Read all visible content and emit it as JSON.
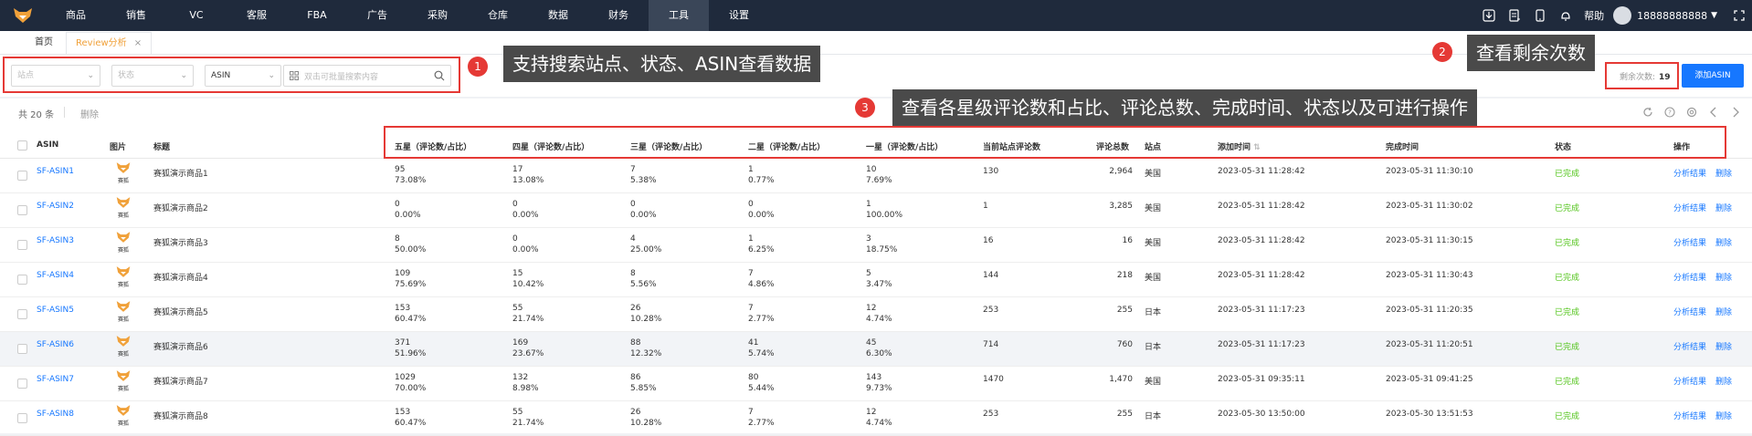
{
  "nav": {
    "items": [
      "商品",
      "销售",
      "VC",
      "客服",
      "FBA",
      "广告",
      "采购",
      "仓库",
      "数据",
      "财务",
      "工具",
      "设置"
    ],
    "active_index": 10,
    "help": "帮助",
    "user": "18888888888"
  },
  "tabs": {
    "home": "首页",
    "active": "Review分析",
    "close": "×"
  },
  "filters": {
    "site_placeholder": "站点",
    "status_placeholder": "状态",
    "type_value": "ASIN",
    "search_placeholder": "双击可批量搜索内容"
  },
  "annotations": {
    "a1_num": "1",
    "a1_text": "支持搜索站点、状态、ASIN查看数据",
    "a2_num": "2",
    "a2_text": "查看剩余次数",
    "a3_num": "3",
    "a3_text": "查看各星级评论数和占比、评论总数、完成时间、状态以及可进行操作"
  },
  "remaining": {
    "label": "剩余次数:",
    "value": "19"
  },
  "add_button": "添加ASIN",
  "toolbar": {
    "count": "共 20 条",
    "delete": "删除"
  },
  "columns": {
    "asin": "ASIN",
    "image": "图片",
    "title": "标题",
    "five": "五星（评论数/占比）",
    "four": "四星（评论数/占比）",
    "three": "三星（评论数/占比）",
    "two": "二星（评论数/占比）",
    "one": "一星（评论数/占比）",
    "site_reviews": "当前站点评论数",
    "total": "评论总数",
    "site": "站点",
    "added": "添加时间",
    "completed": "完成时间",
    "status": "状态",
    "action": "操作"
  },
  "thumb_text": "赛狐",
  "rows": [
    {
      "asin": "SF-ASIN1",
      "title": "赛狐演示商品1",
      "s5": "95",
      "p5": "73.08%",
      "s4": "17",
      "p4": "13.08%",
      "s3": "7",
      "p3": "5.38%",
      "s2": "1",
      "p2": "0.77%",
      "s1": "10",
      "p1": "7.69%",
      "site_reviews": "130",
      "total": "2,964",
      "site": "美国",
      "added": "2023-05-31 11:28:42",
      "completed": "2023-05-31 11:30:10",
      "status": "已完成",
      "act1": "分析结果",
      "act2": "删除"
    },
    {
      "asin": "SF-ASIN2",
      "title": "赛狐演示商品2",
      "s5": "0",
      "p5": "0.00%",
      "s4": "0",
      "p4": "0.00%",
      "s3": "0",
      "p3": "0.00%",
      "s2": "0",
      "p2": "0.00%",
      "s1": "1",
      "p1": "100.00%",
      "site_reviews": "1",
      "total": "3,285",
      "site": "美国",
      "added": "2023-05-31 11:28:42",
      "completed": "2023-05-31 11:30:02",
      "status": "已完成",
      "act1": "分析结果",
      "act2": "删除"
    },
    {
      "asin": "SF-ASIN3",
      "title": "赛狐演示商品3",
      "s5": "8",
      "p5": "50.00%",
      "s4": "0",
      "p4": "0.00%",
      "s3": "4",
      "p3": "25.00%",
      "s2": "1",
      "p2": "6.25%",
      "s1": "3",
      "p1": "18.75%",
      "site_reviews": "16",
      "total": "16",
      "site": "美国",
      "added": "2023-05-31 11:28:42",
      "completed": "2023-05-31 11:30:15",
      "status": "已完成",
      "act1": "分析结果",
      "act2": "删除"
    },
    {
      "asin": "SF-ASIN4",
      "title": "赛狐演示商品4",
      "s5": "109",
      "p5": "75.69%",
      "s4": "15",
      "p4": "10.42%",
      "s3": "8",
      "p3": "5.56%",
      "s2": "7",
      "p2": "4.86%",
      "s1": "5",
      "p1": "3.47%",
      "site_reviews": "144",
      "total": "218",
      "site": "美国",
      "added": "2023-05-31 11:28:42",
      "completed": "2023-05-31 11:30:43",
      "status": "已完成",
      "act1": "分析结果",
      "act2": "删除"
    },
    {
      "asin": "SF-ASIN5",
      "title": "赛狐演示商品5",
      "s5": "153",
      "p5": "60.47%",
      "s4": "55",
      "p4": "21.74%",
      "s3": "26",
      "p3": "10.28%",
      "s2": "7",
      "p2": "2.77%",
      "s1": "12",
      "p1": "4.74%",
      "site_reviews": "253",
      "total": "255",
      "site": "日本",
      "added": "2023-05-31 11:17:23",
      "completed": "2023-05-31 11:20:35",
      "status": "已完成",
      "act1": "分析结果",
      "act2": "删除"
    },
    {
      "asin": "SF-ASIN6",
      "title": "赛狐演示商品6",
      "s5": "371",
      "p5": "51.96%",
      "s4": "169",
      "p4": "23.67%",
      "s3": "88",
      "p3": "12.32%",
      "s2": "41",
      "p2": "5.74%",
      "s1": "45",
      "p1": "6.30%",
      "site_reviews": "714",
      "total": "760",
      "site": "日本",
      "added": "2023-05-31 11:17:23",
      "completed": "2023-05-31 11:20:51",
      "status": "已完成",
      "act1": "分析结果",
      "act2": "删除"
    },
    {
      "asin": "SF-ASIN7",
      "title": "赛狐演示商品7",
      "s5": "1029",
      "p5": "70.00%",
      "s4": "132",
      "p4": "8.98%",
      "s3": "86",
      "p3": "5.85%",
      "s2": "80",
      "p2": "5.44%",
      "s1": "143",
      "p1": "9.73%",
      "site_reviews": "1470",
      "total": "1,470",
      "site": "美国",
      "added": "2023-05-31 09:35:11",
      "completed": "2023-05-31 09:41:25",
      "status": "已完成",
      "act1": "分析结果",
      "act2": "删除"
    },
    {
      "asin": "SF-ASIN8",
      "title": "赛狐演示商品8",
      "s5": "153",
      "p5": "60.47%",
      "s4": "55",
      "p4": "21.74%",
      "s3": "26",
      "p3": "10.28%",
      "s2": "7",
      "p2": "2.77%",
      "s1": "12",
      "p1": "4.74%",
      "site_reviews": "253",
      "total": "255",
      "site": "日本",
      "added": "2023-05-30 13:50:00",
      "completed": "2023-05-30 13:51:53",
      "status": "已完成",
      "act1": "分析结果",
      "act2": "删除"
    }
  ]
}
